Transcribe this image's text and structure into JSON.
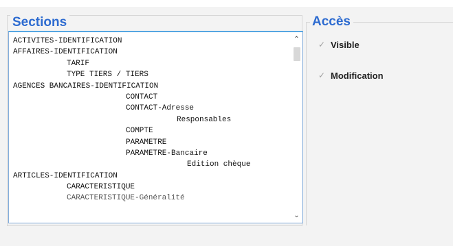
{
  "sections": {
    "title": "Sections",
    "items": [
      {
        "label": "ACTIVITES-IDENTIFICATION",
        "indent": 0
      },
      {
        "label": "AFFAIRES-IDENTIFICATION",
        "indent": 0
      },
      {
        "label": "TARIF",
        "indent": 1
      },
      {
        "label": "TYPE TIERS / TIERS",
        "indent": 1
      },
      {
        "label": "AGENCES BANCAIRES-IDENTIFICATION",
        "indent": 0
      },
      {
        "label": "CONTACT",
        "indent": 2
      },
      {
        "label": "CONTACT-Adresse",
        "indent": 2
      },
      {
        "label": "Responsables",
        "indent": 3
      },
      {
        "label": "COMPTE",
        "indent": 2
      },
      {
        "label": "PARAMETRE",
        "indent": 2
      },
      {
        "label": "PARAMETRE-Bancaire",
        "indent": 2
      },
      {
        "label": "Edition chèque",
        "indent": 4
      },
      {
        "label": "ARTICLES-IDENTIFICATION",
        "indent": 0
      },
      {
        "label": "CARACTERISTIQUE",
        "indent": 1
      },
      {
        "label": "CARACTERISTIQUE-Généralité",
        "indent": 1
      }
    ],
    "scroll_up_icon": "chevron-up-icon",
    "scroll_down_icon": "chevron-down-icon"
  },
  "acces": {
    "title": "Accès",
    "visible": {
      "label": "Visible",
      "checked": true
    },
    "modification": {
      "label": "Modification",
      "checked": true
    }
  },
  "colors": {
    "accent_title": "#2d6bd0",
    "list_border": "#55a6e2"
  }
}
